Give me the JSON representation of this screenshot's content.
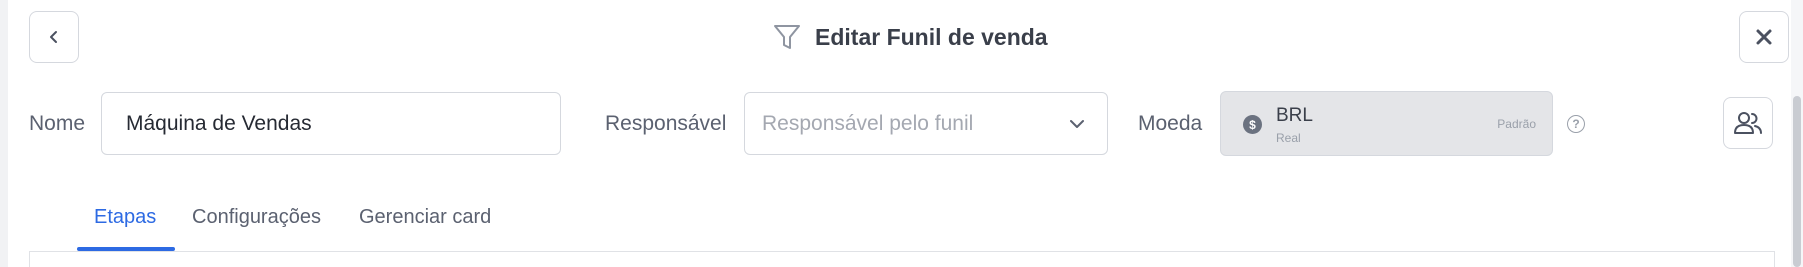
{
  "header": {
    "title": "Editar Funil de venda",
    "back_icon": "chevron-left-icon",
    "close_icon": "close-icon",
    "title_icon": "funnel-icon"
  },
  "form": {
    "nome": {
      "label": "Nome",
      "value": "Máquina de Vendas"
    },
    "responsavel": {
      "label": "Responsável",
      "placeholder": "Responsável pelo funil"
    },
    "moeda": {
      "label": "Moeda",
      "code": "BRL",
      "name": "Real",
      "tag": "Padrão",
      "coin_symbol": "$"
    },
    "help_symbol": "?"
  },
  "tabs": [
    {
      "label": "Etapas",
      "active": true
    },
    {
      "label": "Configurações",
      "active": false
    },
    {
      "label": "Gerenciar card",
      "active": false
    }
  ],
  "colors": {
    "accent": "#2d6ae3",
    "text": "#3a3f4a",
    "muted": "#a4a8b1",
    "border": "#d5d8de",
    "disabled_bg": "#e4e5e8"
  }
}
